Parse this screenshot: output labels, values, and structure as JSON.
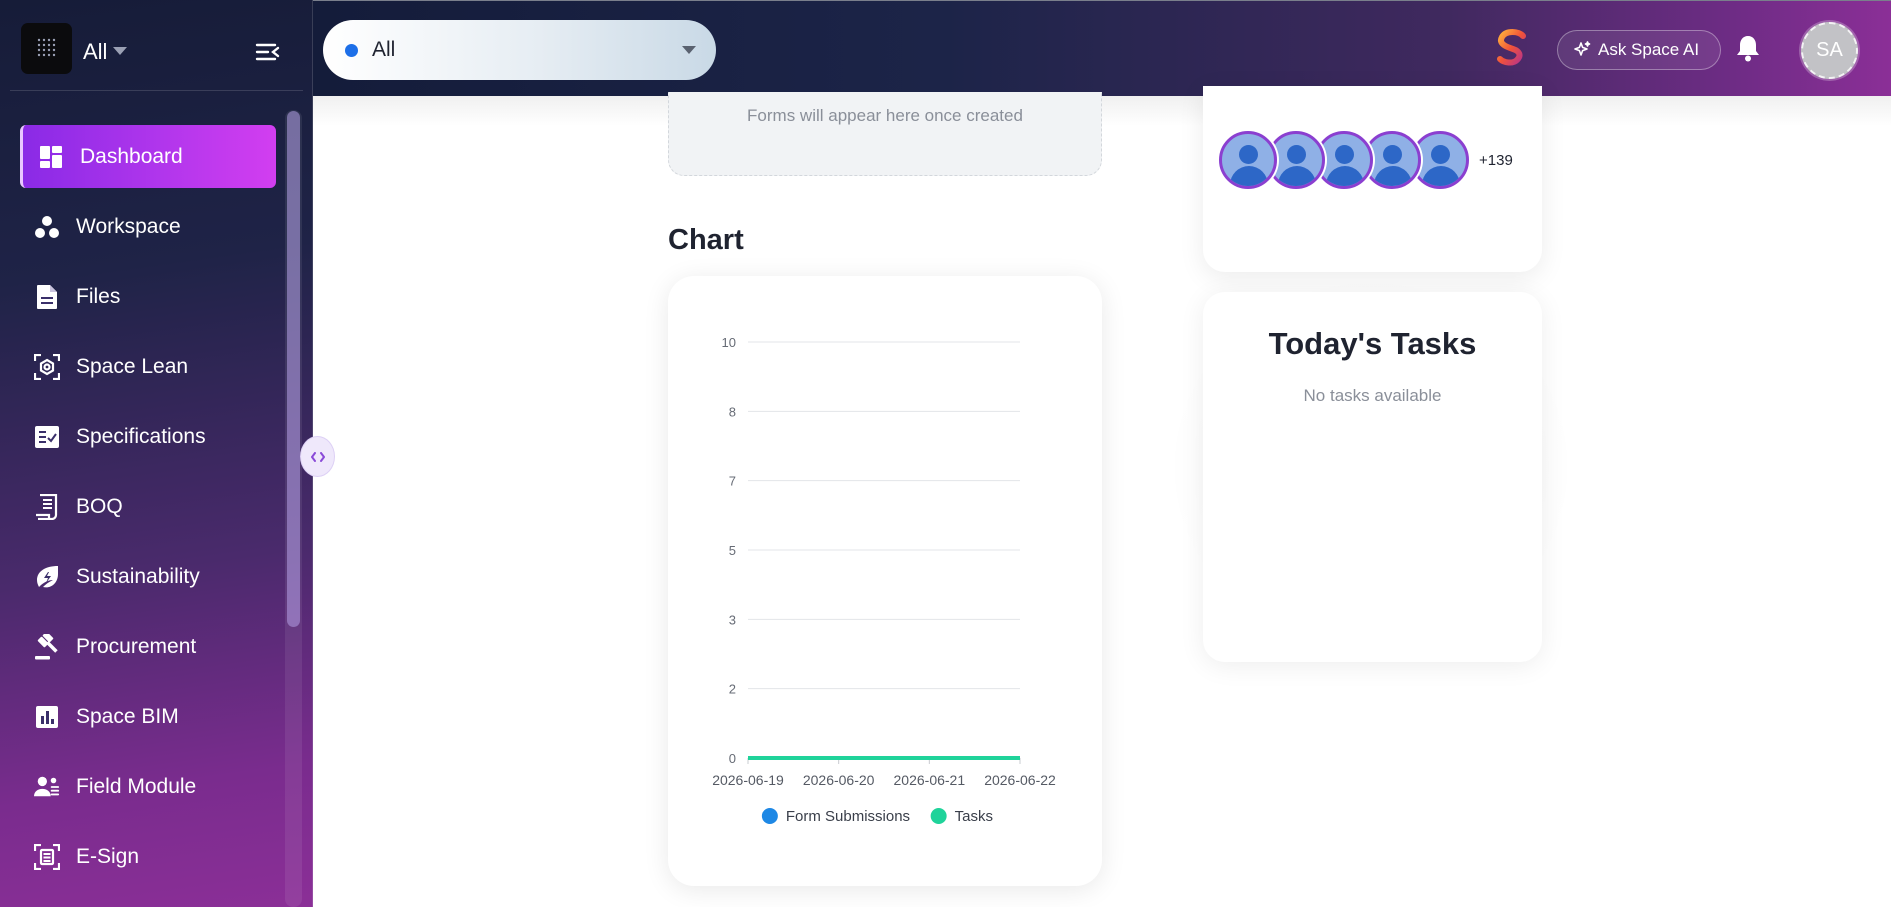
{
  "sidebar": {
    "workspace_label": "All",
    "items": [
      {
        "label": "Dashboard",
        "icon": "dashboard-icon",
        "active": true
      },
      {
        "label": "Workspace",
        "icon": "workspace-icon"
      },
      {
        "label": "Files",
        "icon": "file-icon"
      },
      {
        "label": "Space Lean",
        "icon": "lean-icon"
      },
      {
        "label": "Specifications",
        "icon": "specifications-icon"
      },
      {
        "label": "BOQ",
        "icon": "boq-icon"
      },
      {
        "label": "Sustainability",
        "icon": "sustainability-icon"
      },
      {
        "label": "Procurement",
        "icon": "gavel-icon"
      },
      {
        "label": "Space BIM",
        "icon": "bim-chart-icon"
      },
      {
        "label": "Field Module",
        "icon": "field-team-icon"
      },
      {
        "label": "E-Sign",
        "icon": "esign-icon"
      }
    ]
  },
  "topbar": {
    "filter": {
      "value": "All",
      "dot_color": "#1d6fe8"
    },
    "ask_ai_label": "Ask Space AI",
    "avatar_initials": "SA"
  },
  "forms": {
    "empty_text": "Forms will appear here once created"
  },
  "members": {
    "visible_count": 5,
    "more_label": "+139"
  },
  "chart_section": {
    "heading": "Chart"
  },
  "tasks": {
    "title": "Today's Tasks",
    "empty_text": "No tasks available"
  },
  "colors": {
    "accent": "#b136ec",
    "series_form": "#1e88e5",
    "series_tasks": "#1fd39a"
  },
  "chart_data": {
    "type": "line",
    "x": [
      "2026-06-19",
      "2026-06-20",
      "2026-06-21",
      "2026-06-22"
    ],
    "y_ticks": [
      "0",
      "2",
      "3",
      "5",
      "7",
      "8",
      "10"
    ],
    "ylim": [
      0,
      10
    ],
    "series": [
      {
        "name": "Form Submissions",
        "values": [
          0,
          0,
          0,
          0
        ],
        "color": "#1e88e5"
      },
      {
        "name": "Tasks",
        "values": [
          0,
          0,
          0,
          0
        ],
        "color": "#1fd39a"
      }
    ],
    "legend": "bottom",
    "grid": true
  }
}
